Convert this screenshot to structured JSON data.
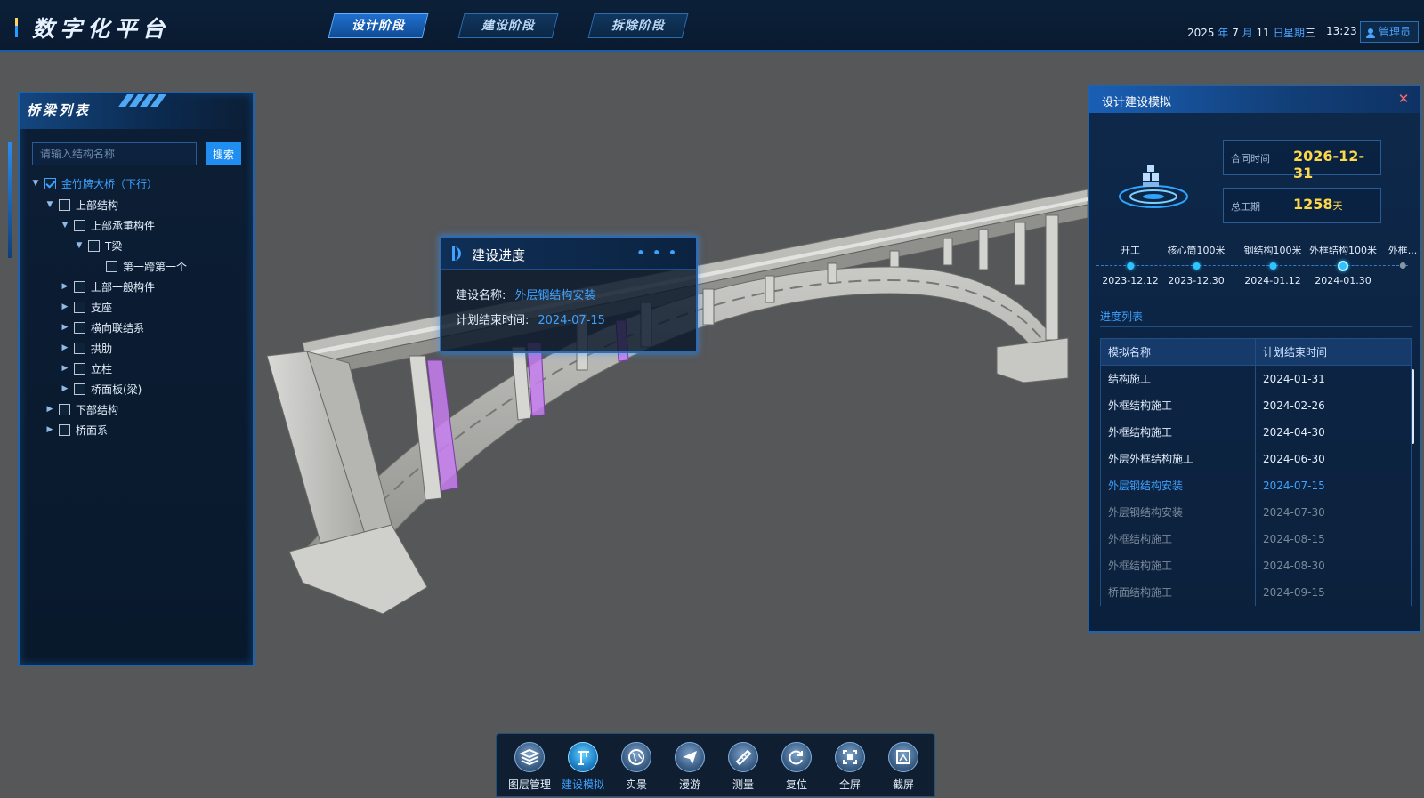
{
  "header": {
    "title": "数字化平台",
    "stages": [
      {
        "label": "设计阶段",
        "active": true
      },
      {
        "label": "建设阶段",
        "active": false
      },
      {
        "label": "拆除阶段",
        "active": false
      }
    ],
    "date": {
      "year": "2025",
      "year_unit": "年",
      "month": "7",
      "month_unit": "月",
      "day": "11",
      "day_unit": "日",
      "weekday_label": "星期",
      "weekday": "三",
      "time": "13:23"
    },
    "user": "管理员"
  },
  "left_panel": {
    "title": "桥梁列表",
    "search_placeholder": "请输入结构名称",
    "search_button": "搜索",
    "tree": [
      {
        "label": "金竹牌大桥（下行）",
        "checked": true,
        "expanded": true
      },
      {
        "label": "上部结构",
        "checked": false,
        "expanded": true
      },
      {
        "label": "上部承重构件",
        "checked": false,
        "expanded": true
      },
      {
        "label": "T梁",
        "checked": false,
        "expanded": true
      },
      {
        "label": "第一跨第一个",
        "checked": false
      },
      {
        "label": "上部一般构件",
        "checked": false
      },
      {
        "label": "支座",
        "checked": false
      },
      {
        "label": "横向联结系",
        "checked": false
      },
      {
        "label": "拱肋",
        "checked": false
      },
      {
        "label": "立柱",
        "checked": false
      },
      {
        "label": "桥面板(梁)",
        "checked": false
      },
      {
        "label": "下部结构",
        "checked": false
      },
      {
        "label": "桥面系",
        "checked": false
      }
    ]
  },
  "progress_card": {
    "title": "建设进度",
    "name_label": "建设名称:",
    "name_value": "外层钢结构安装",
    "end_label": "计划结束时间:",
    "end_value": "2024-07-15"
  },
  "right_panel": {
    "title": "设计建设模拟",
    "contract_label": "合同时间",
    "contract_value": "2026-12-31",
    "duration_label": "总工期",
    "duration_value": "1258",
    "duration_unit": "天",
    "timeline": [
      {
        "label": "开工",
        "date": "2023-12.12",
        "state": "done"
      },
      {
        "label": "核心筒100米",
        "date": "2023-12.30",
        "state": "done"
      },
      {
        "label": "钢结构100米",
        "date": "2024-01.12",
        "state": "done"
      },
      {
        "label": "外框结构100米",
        "date": "2024-01.30",
        "state": "current"
      },
      {
        "label": "外框...",
        "date": "",
        "state": "future"
      }
    ],
    "list_title": "进度列表",
    "columns": [
      "模拟名称",
      "计划结束时间"
    ],
    "rows": [
      {
        "name": "结构施工",
        "date": "2024-01-31",
        "state": "done"
      },
      {
        "name": "外框结构施工",
        "date": "2024-02-26",
        "state": "done"
      },
      {
        "name": "外框结构施工",
        "date": "2024-04-30",
        "state": "done"
      },
      {
        "name": "外层外框结构施工",
        "date": "2024-06-30",
        "state": "done"
      },
      {
        "name": "外层钢结构安装",
        "date": "2024-07-15",
        "state": "active"
      },
      {
        "name": "外层钢结构安装",
        "date": "2024-07-30",
        "state": "future"
      },
      {
        "name": "外框结构施工",
        "date": "2024-08-15",
        "state": "future"
      },
      {
        "name": "外框结构施工",
        "date": "2024-08-30",
        "state": "future"
      },
      {
        "name": "桥面结构施工",
        "date": "2024-09-15",
        "state": "future"
      }
    ]
  },
  "toolbar": [
    {
      "label": "图层管理",
      "icon": "layers-icon",
      "active": false
    },
    {
      "label": "建设模拟",
      "icon": "crane-icon",
      "active": true
    },
    {
      "label": "实景",
      "icon": "globe-icon",
      "active": false
    },
    {
      "label": "漫游",
      "icon": "paper-plane-icon",
      "active": false
    },
    {
      "label": "测量",
      "icon": "ruler-icon",
      "active": false
    },
    {
      "label": "复位",
      "icon": "reset-icon",
      "active": false
    },
    {
      "label": "全屏",
      "icon": "fullscreen-icon",
      "active": false
    },
    {
      "label": "截屏",
      "icon": "screenshot-icon",
      "active": false
    }
  ],
  "colors": {
    "accent": "#3ea2ff",
    "highlight_member": "#c77ef0",
    "stat_value": "#ffd84a",
    "background": "#555759"
  }
}
